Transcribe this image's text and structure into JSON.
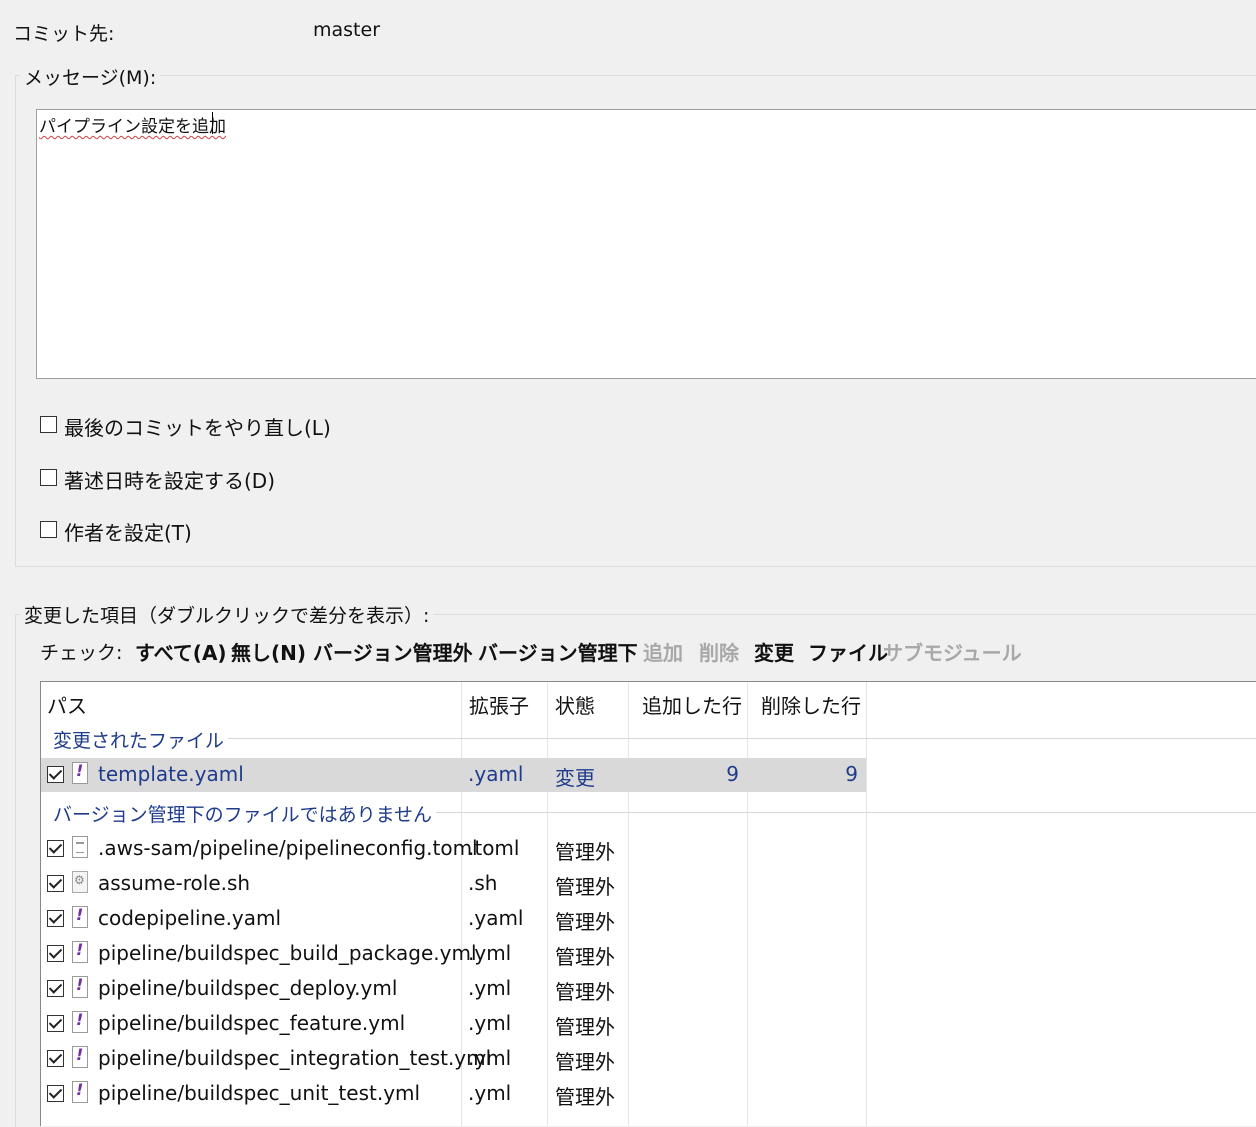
{
  "commit": {
    "label": "コミット先:",
    "branch": "master"
  },
  "message": {
    "group_title": "メッセージ(M):",
    "text": "パイプライン設定を追加"
  },
  "options": [
    {
      "label": "最後のコミットをやり直し(L)",
      "checked": false
    },
    {
      "label": "著述日時を設定する(D)",
      "checked": false
    },
    {
      "label": "作者を設定(T)",
      "checked": false
    }
  ],
  "changes": {
    "group_title": "変更した項目（ダブルクリックで差分を表示）:",
    "check_label": "チェック:",
    "filters": [
      {
        "label": "すべて(A)",
        "enabled": true
      },
      {
        "label": "無し(N)",
        "enabled": true
      },
      {
        "label": "バージョン管理外",
        "enabled": true
      },
      {
        "label": "バージョン管理下",
        "enabled": true
      },
      {
        "label": "追加",
        "enabled": false
      },
      {
        "label": "削除",
        "enabled": false
      },
      {
        "label": "変更",
        "enabled": true
      },
      {
        "label": "ファイル",
        "enabled": true
      },
      {
        "label": "サブモジュール",
        "enabled": false
      }
    ],
    "columns": [
      "パス",
      "拡張子",
      "状態",
      "追加した行",
      "削除した行"
    ],
    "groups": [
      {
        "title": "変更されたファイル",
        "rows": [
          {
            "path": "template.yaml",
            "ext": ".yaml",
            "status": "変更",
            "added": "9",
            "deleted": "9",
            "checked": true,
            "icon": "yaml-file-icon",
            "selected": true
          }
        ]
      },
      {
        "title": "バージョン管理下のファイルではありません",
        "rows": [
          {
            "path": ".aws-sam/pipeline/pipelineconfig.toml",
            "ext": ".toml",
            "status": "管理外",
            "checked": true,
            "icon": "text-file-icon"
          },
          {
            "path": "assume-role.sh",
            "ext": ".sh",
            "status": "管理外",
            "checked": true,
            "icon": "script-file-icon"
          },
          {
            "path": "codepipeline.yaml",
            "ext": ".yaml",
            "status": "管理外",
            "checked": true,
            "icon": "yaml-file-icon"
          },
          {
            "path": "pipeline/buildspec_build_package.yml",
            "ext": ".yml",
            "status": "管理外",
            "checked": true,
            "icon": "yaml-file-icon"
          },
          {
            "path": "pipeline/buildspec_deploy.yml",
            "ext": ".yml",
            "status": "管理外",
            "checked": true,
            "icon": "yaml-file-icon"
          },
          {
            "path": "pipeline/buildspec_feature.yml",
            "ext": ".yml",
            "status": "管理外",
            "checked": true,
            "icon": "yaml-file-icon"
          },
          {
            "path": "pipeline/buildspec_integration_test.yml",
            "ext": ".yml",
            "status": "管理外",
            "checked": true,
            "icon": "yaml-file-icon"
          },
          {
            "path": "pipeline/buildspec_unit_test.yml",
            "ext": ".yml",
            "status": "管理外",
            "checked": true,
            "icon": "yaml-file-icon"
          }
        ]
      }
    ]
  },
  "colors": {
    "group_text": "#1f3c8c",
    "selected_row": "#d9d9d9",
    "disabled_text": "#a8a8a8"
  }
}
